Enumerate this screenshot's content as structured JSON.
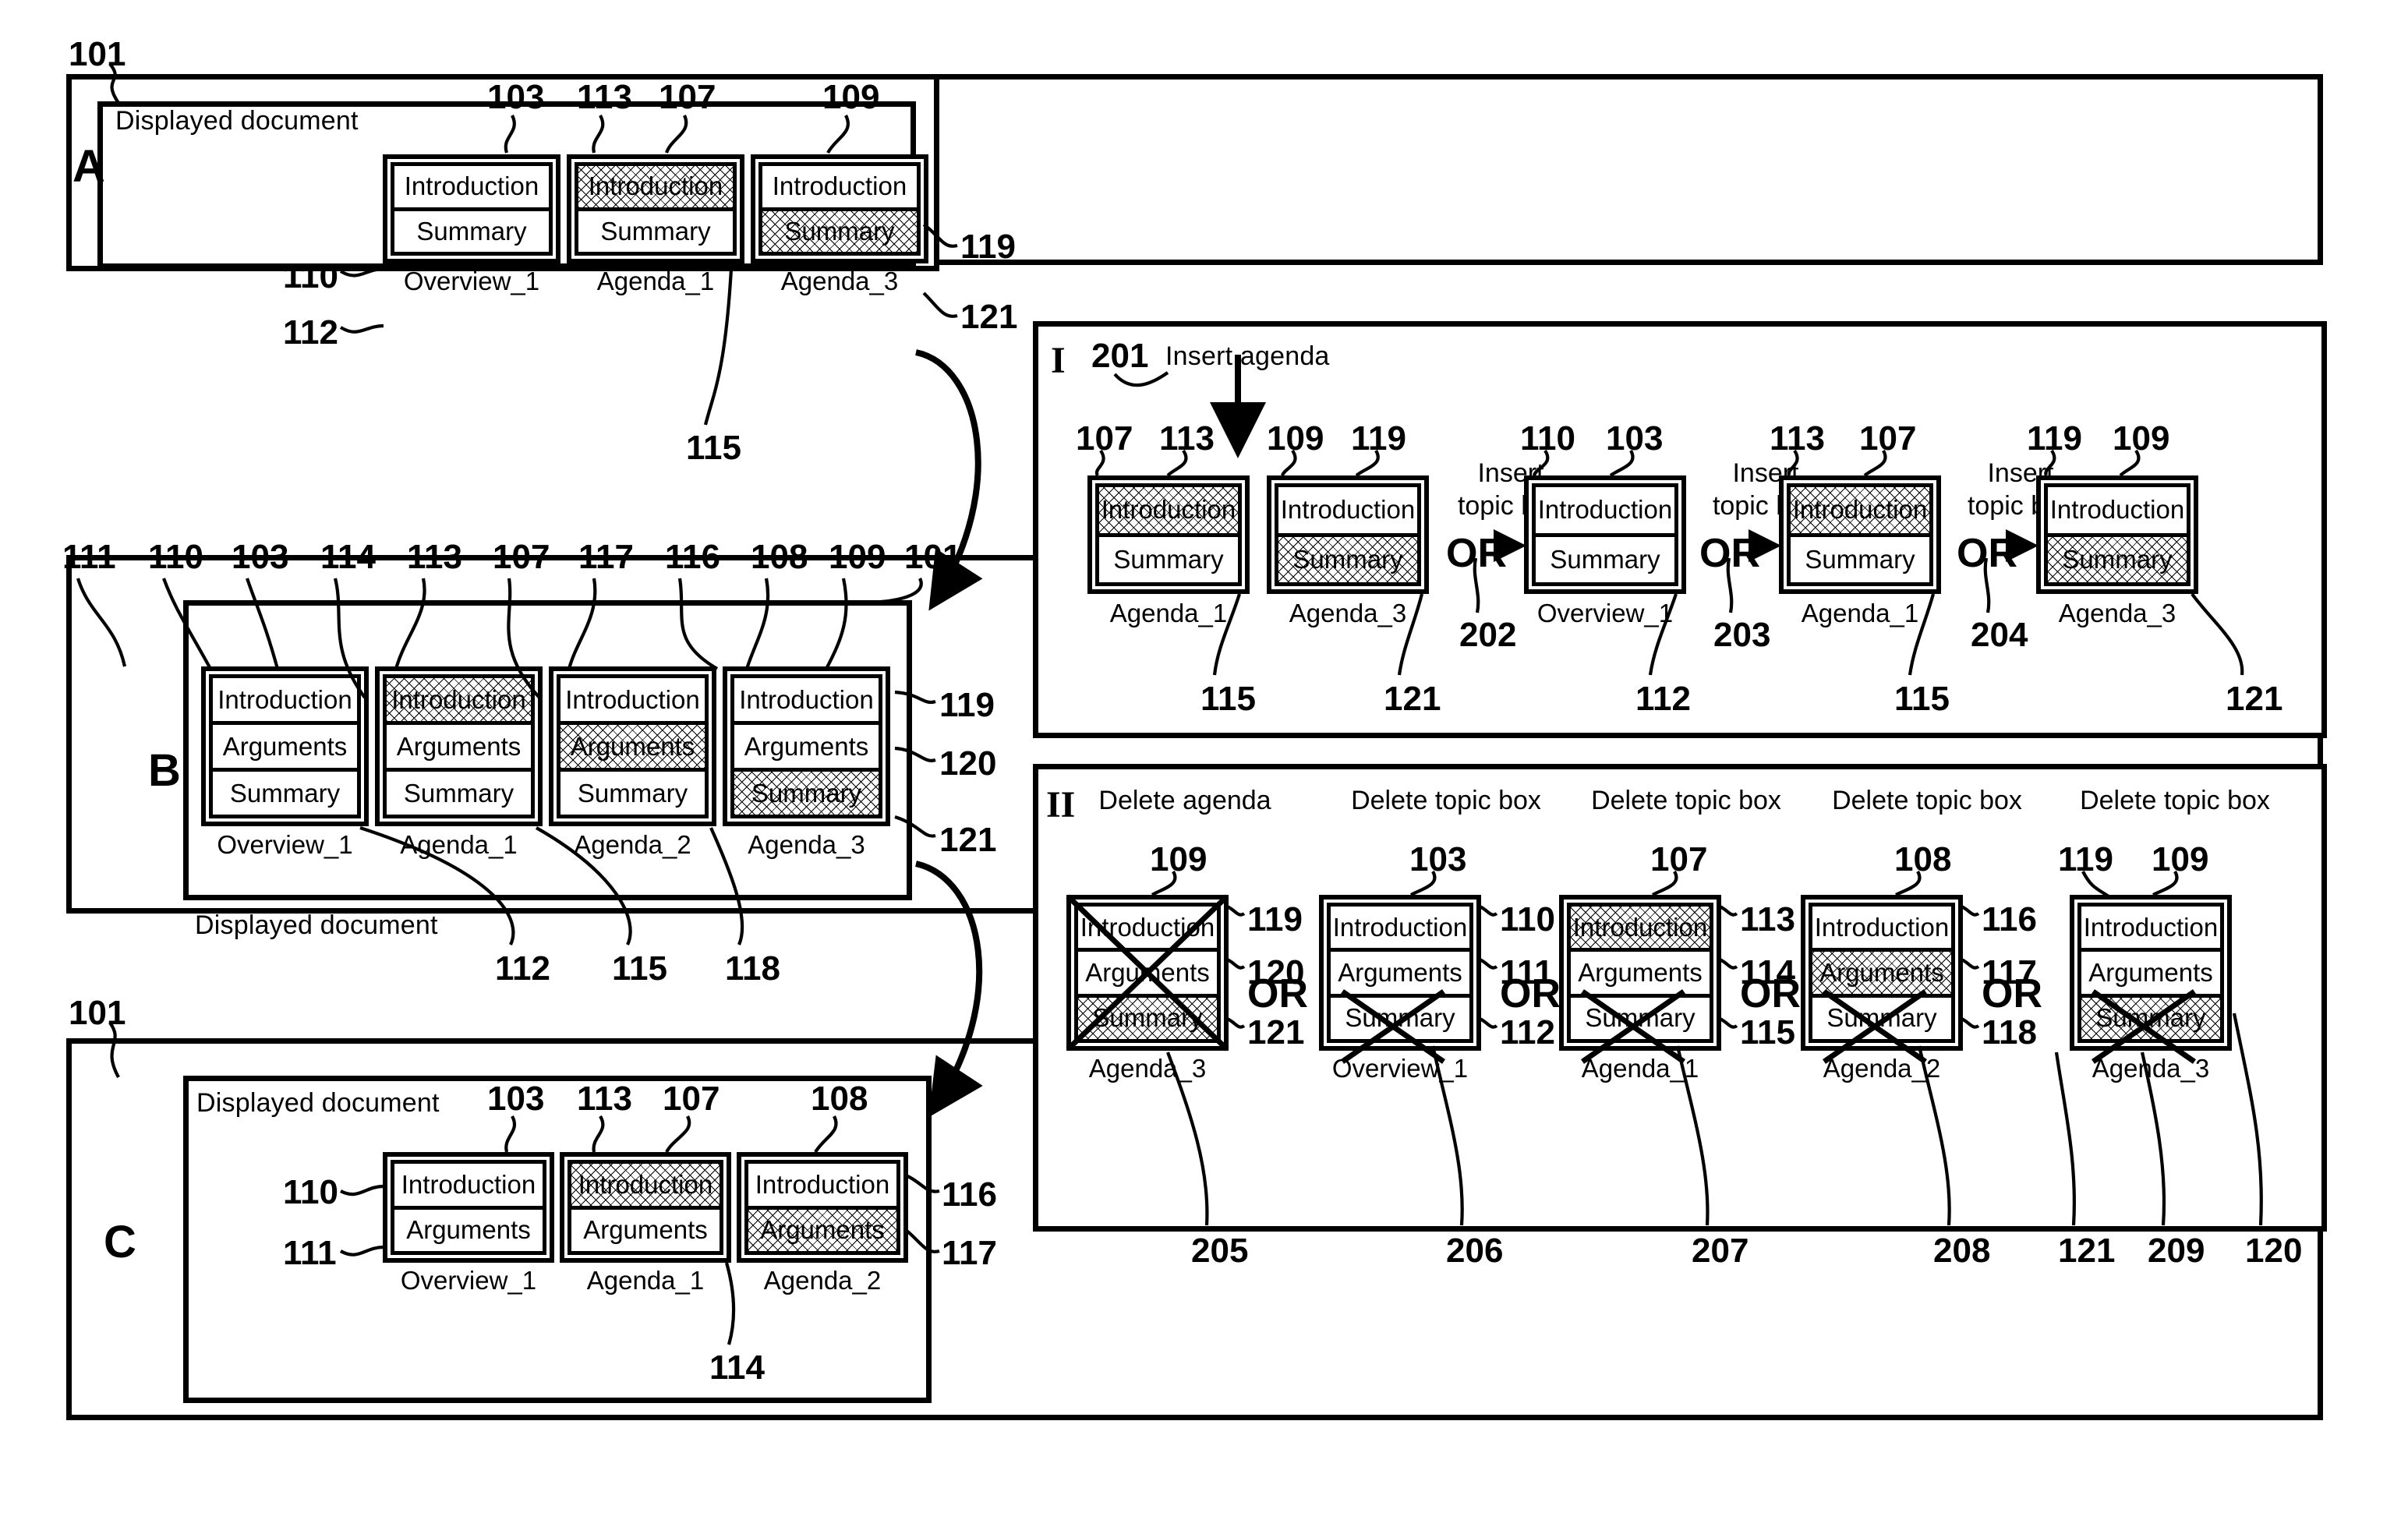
{
  "figure": {
    "doc_label": "Displayed document",
    "panel_letters": {
      "a": "A",
      "b": "B",
      "c": "C"
    },
    "section_numerals": {
      "one": "I",
      "two": "II"
    },
    "topics": {
      "introduction": "Introduction",
      "arguments": "Arguments",
      "summary": "Summary"
    },
    "agenda_names": {
      "overview1": "Overview_1",
      "agenda1": "Agenda_1",
      "agenda2": "Agenda_2",
      "agenda3": "Agenda_3"
    },
    "operations": {
      "insert_agenda": "Insert agenda",
      "insert_topic_box": "Insert\ntopic box",
      "insert_topic_box_l1": "Insert",
      "insert_topic_box_l2": "topic box",
      "delete_agenda": "Delete agenda",
      "delete_topic_box": "Delete topic box",
      "or": "OR"
    }
  },
  "panelA": {
    "doc_label": "Displayed document",
    "letter": "A",
    "ref_outer": "101",
    "refs_top": [
      "103",
      "113",
      "107",
      "109"
    ],
    "refs_left": [
      "110",
      "112"
    ],
    "refs_right": [
      "119",
      "121"
    ],
    "ref_bottom": "115",
    "boxes": [
      {
        "name": "Overview_1",
        "rows": [
          {
            "label": "Introduction",
            "hatched": false
          },
          {
            "label": "Summary",
            "hatched": false
          }
        ]
      },
      {
        "name": "Agenda_1",
        "rows": [
          {
            "label": "Introduction",
            "hatched": true
          },
          {
            "label": "Summary",
            "hatched": false
          }
        ]
      },
      {
        "name": "Agenda_3",
        "rows": [
          {
            "label": "Introduction",
            "hatched": false
          },
          {
            "label": "Summary",
            "hatched": true
          }
        ]
      }
    ]
  },
  "panelB": {
    "doc_label": "Displayed document",
    "letter": "B",
    "ref_outer": "101",
    "refs_top": [
      "111",
      "110",
      "103",
      "114",
      "113",
      "107",
      "117",
      "116",
      "108",
      "109",
      "101"
    ],
    "refs_right": [
      "119",
      "120",
      "121"
    ],
    "refs_bottom": [
      "112",
      "115",
      "118"
    ],
    "boxes": [
      {
        "name": "Overview_1",
        "rows": [
          {
            "label": "Introduction",
            "hatched": false
          },
          {
            "label": "Arguments",
            "hatched": false
          },
          {
            "label": "Summary",
            "hatched": false
          }
        ]
      },
      {
        "name": "Agenda_1",
        "rows": [
          {
            "label": "Introduction",
            "hatched": true
          },
          {
            "label": "Arguments",
            "hatched": false
          },
          {
            "label": "Summary",
            "hatched": false
          }
        ]
      },
      {
        "name": "Agenda_2",
        "rows": [
          {
            "label": "Introduction",
            "hatched": false
          },
          {
            "label": "Arguments",
            "hatched": true
          },
          {
            "label": "Summary",
            "hatched": false
          }
        ]
      },
      {
        "name": "Agenda_3",
        "rows": [
          {
            "label": "Introduction",
            "hatched": false
          },
          {
            "label": "Arguments",
            "hatched": false
          },
          {
            "label": "Summary",
            "hatched": true
          }
        ]
      }
    ]
  },
  "panelC": {
    "doc_label": "Displayed document",
    "letter": "C",
    "ref_outer": "101",
    "refs_top": [
      "103",
      "113",
      "107",
      "108"
    ],
    "refs_left": [
      "110",
      "111"
    ],
    "refs_right": [
      "116",
      "117"
    ],
    "ref_bottom": "114",
    "boxes": [
      {
        "name": "Overview_1",
        "rows": [
          {
            "label": "Introduction",
            "hatched": false
          },
          {
            "label": "Arguments",
            "hatched": false
          }
        ]
      },
      {
        "name": "Agenda_1",
        "rows": [
          {
            "label": "Introduction",
            "hatched": true
          },
          {
            "label": "Arguments",
            "hatched": false
          }
        ]
      },
      {
        "name": "Agenda_2",
        "rows": [
          {
            "label": "Introduction",
            "hatched": false
          },
          {
            "label": "Arguments",
            "hatched": true
          }
        ]
      }
    ]
  },
  "sectionI": {
    "numeral": "I",
    "header_ref": "201",
    "header_label": "Insert agenda",
    "steps": [
      {
        "name": "Agenda_1",
        "refs_top": [
          "107",
          "113"
        ],
        "ref_bottom": "115",
        "op": null,
        "op_ref": null,
        "rows": [
          {
            "label": "Introduction",
            "hatched": true
          },
          {
            "label": "Summary",
            "hatched": false
          }
        ]
      },
      {
        "name": "Agenda_3",
        "refs_top": [
          "109",
          "119"
        ],
        "ref_bottom": "121",
        "op": null,
        "op_ref": null,
        "rows": [
          {
            "label": "Introduction",
            "hatched": false
          },
          {
            "label": "Summary",
            "hatched": true
          }
        ]
      },
      {
        "name": "Overview_1",
        "refs_top": [
          "110",
          "103"
        ],
        "ref_bottom": "112",
        "op": "Insert topic box",
        "op_ref": "202",
        "rows": [
          {
            "label": "Introduction",
            "hatched": false
          },
          {
            "label": "Summary",
            "hatched": false
          }
        ]
      },
      {
        "name": "Agenda_1",
        "refs_top": [
          "113",
          "107"
        ],
        "ref_bottom": "115",
        "op": "Insert topic box",
        "op_ref": "203",
        "rows": [
          {
            "label": "Introduction",
            "hatched": true
          },
          {
            "label": "Summary",
            "hatched": false
          }
        ]
      },
      {
        "name": "Agenda_3",
        "refs_top": [
          "119",
          "109"
        ],
        "ref_bottom": "121",
        "op": "Insert topic box",
        "op_ref": "204",
        "rows": [
          {
            "label": "Introduction",
            "hatched": false
          },
          {
            "label": "Summary",
            "hatched": true
          }
        ]
      }
    ]
  },
  "sectionII": {
    "numeral": "II",
    "steps": [
      {
        "header": "Delete agenda",
        "name": "Agenda_3",
        "ref_top": "109",
        "refs_right": [
          "119",
          "120",
          "121"
        ],
        "ref_bottom": "205",
        "deleted_whole": true,
        "deleted_row": null,
        "rows": [
          {
            "label": "Introduction",
            "hatched": false
          },
          {
            "label": "Arguments",
            "hatched": false
          },
          {
            "label": "Summary",
            "hatched": true
          }
        ]
      },
      {
        "header": "Delete topic box",
        "name": "Overview_1",
        "ref_top": "103",
        "refs_right": [
          "110",
          "111",
          "112"
        ],
        "ref_bottom": "206",
        "deleted_whole": false,
        "deleted_row": 2,
        "rows": [
          {
            "label": "Introduction",
            "hatched": false
          },
          {
            "label": "Arguments",
            "hatched": false
          },
          {
            "label": "Summary",
            "hatched": false
          }
        ]
      },
      {
        "header": "Delete topic box",
        "name": "Agenda_1",
        "ref_top": "107",
        "refs_right": [
          "113",
          "114",
          "115"
        ],
        "ref_bottom": "207",
        "deleted_whole": false,
        "deleted_row": 2,
        "rows": [
          {
            "label": "Introduction",
            "hatched": true
          },
          {
            "label": "Arguments",
            "hatched": false
          },
          {
            "label": "Summary",
            "hatched": false
          }
        ]
      },
      {
        "header": "Delete topic box",
        "name": "Agenda_2",
        "ref_top": "108",
        "refs_right": [
          "116",
          "117",
          "118"
        ],
        "ref_bottom": "208",
        "deleted_whole": false,
        "deleted_row": 2,
        "rows": [
          {
            "label": "Introduction",
            "hatched": false
          },
          {
            "label": "Arguments",
            "hatched": true
          },
          {
            "label": "Summary",
            "hatched": false
          }
        ]
      },
      {
        "header": "Delete topic box",
        "name": "Agenda_3",
        "ref_top": "109",
        "ref_top_extra": "119",
        "refs_right": [],
        "ref_bottom": "209",
        "deleted_whole": false,
        "deleted_row": 2,
        "rows": [
          {
            "label": "Introduction",
            "hatched": false
          },
          {
            "label": "Arguments",
            "hatched": false
          },
          {
            "label": "Summary",
            "hatched": true
          }
        ]
      }
    ],
    "trailing_refs": [
      "121",
      "120"
    ]
  }
}
